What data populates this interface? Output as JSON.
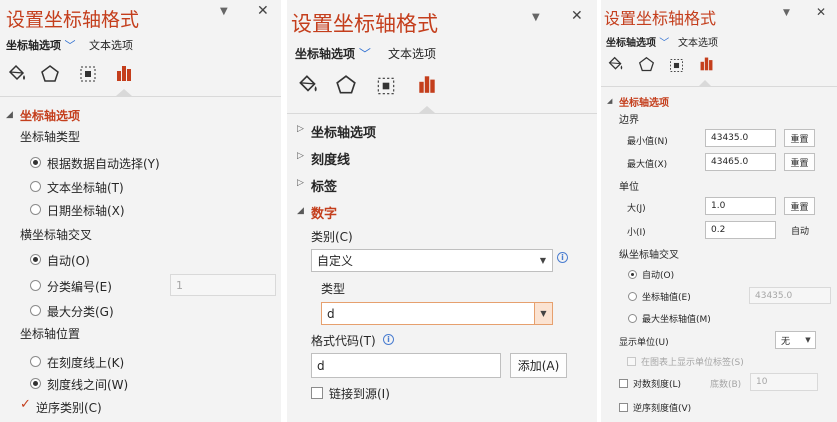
{
  "common": {
    "title": "设置坐标轴格式",
    "tab_axis": "坐标轴选项",
    "tab_text": "文本选项",
    "close": "✕",
    "menu": "▼"
  },
  "p1": {
    "section": "坐标轴选项",
    "type_label": "坐标轴类型",
    "type_auto": "根据数据自动选择(Y)",
    "type_text": "文本坐标轴(T)",
    "type_date": "日期坐标轴(X)",
    "cross_label": "横坐标轴交叉",
    "cross_auto": "自动(O)",
    "cross_cat": "分类编号(E)",
    "cross_cat_value": "1",
    "cross_max": "最大分类(G)",
    "pos_label": "坐标轴位置",
    "pos_on": "在刻度线上(K)",
    "pos_between": "刻度线之间(W)",
    "reverse": "逆序类别(C)"
  },
  "p2": {
    "sec_axis": "坐标轴选项",
    "sec_ticks": "刻度线",
    "sec_labels": "标签",
    "sec_number": "数字",
    "category_label": "类别(C)",
    "category_value": "自定义",
    "type_label": "类型",
    "type_value": "d",
    "code_label": "格式代码(T)",
    "code_value": "d",
    "add_button": "添加(A)",
    "link_source": "链接到源(I)"
  },
  "p3": {
    "section": "坐标轴选项",
    "bounds": "边界",
    "min_label": "最小值(N)",
    "min_value": "43435.0",
    "max_label": "最大值(X)",
    "max_value": "43465.0",
    "reset": "重置",
    "units": "单位",
    "major_label": "大(J)",
    "major_value": "1.0",
    "minor_label": "小(I)",
    "minor_value": "0.2",
    "auto": "自动",
    "vcross": "纵坐标轴交叉",
    "vc_auto": "自动(O)",
    "vc_value_label": "坐标轴值(E)",
    "vc_value": "43435.0",
    "vc_max": "最大坐标轴值(M)",
    "display_units_label": "显示单位(U)",
    "display_units_value": "无",
    "show_units_label": "在图表上显示单位标签(S)",
    "log_scale": "对数刻度(L)",
    "base_label": "底数(B)",
    "base_value": "10",
    "reverse_values": "逆序刻度值(V)"
  },
  "colors": {
    "accent": "#c43e1c",
    "panel_bg": "#f3f3f3",
    "chevron": "#2f6fd0"
  }
}
